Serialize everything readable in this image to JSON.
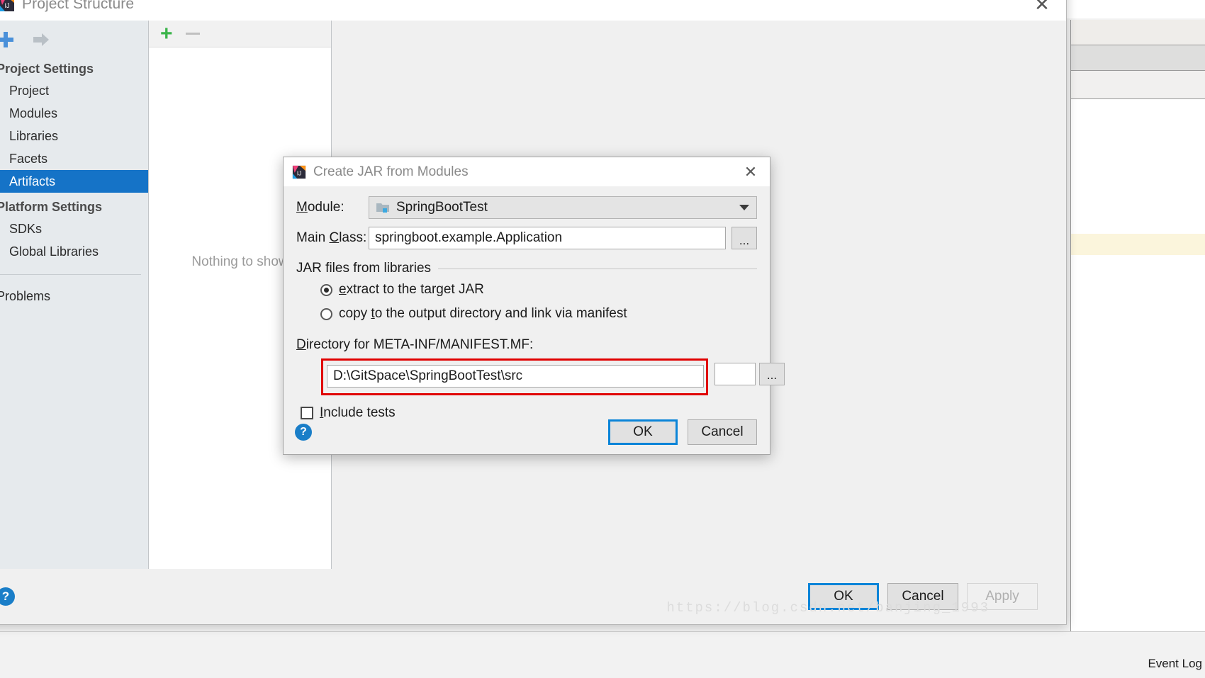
{
  "project_structure": {
    "title": "Project Structure",
    "title_icon": "intellij-idea-icon",
    "close_icon": "close-icon",
    "sidebar": {
      "toolbar": [
        {
          "name": "add-icon",
          "glyph": "+"
        },
        {
          "name": "forward-arrow-icon",
          "glyph": "⇨"
        }
      ],
      "groups": [
        {
          "title": "Project Settings",
          "items": [
            {
              "label": "Project",
              "selected": false
            },
            {
              "label": "Modules",
              "selected": false
            },
            {
              "label": "Libraries",
              "selected": false
            },
            {
              "label": "Facets",
              "selected": false
            },
            {
              "label": "Artifacts",
              "selected": true
            }
          ]
        },
        {
          "title": "Platform Settings",
          "items": [
            {
              "label": "SDKs",
              "selected": false
            },
            {
              "label": "Global Libraries",
              "selected": false
            }
          ]
        }
      ],
      "problems_label": "Problems"
    },
    "middle_panel": {
      "add_button": "+",
      "remove_button": "—",
      "empty_text": "Nothing to show"
    },
    "footer": {
      "help_label": "?",
      "ok_label": "OK",
      "cancel_label": "Cancel",
      "apply_label": "Apply",
      "apply_disabled": true,
      "watermark": "https://blog.csdn.net/banjing_1993"
    },
    "accent_color": "#1573c7",
    "focus_color": "#0a84d8"
  },
  "create_jar_dialog": {
    "title": "Create JAR from Modules",
    "title_icon": "intellij-idea-icon",
    "close_icon": "close-icon",
    "module": {
      "label_prefix": "",
      "label_mnemonic": "M",
      "label_suffix": "odule:",
      "icon": "module-folder-icon",
      "value": "SpringBootTest",
      "arrow_icon": "chevron-down-icon"
    },
    "main_class": {
      "label_prefix": "Main ",
      "label_mnemonic": "C",
      "label_suffix": "lass:",
      "value": "springboot.example.Application",
      "browse_label": "..."
    },
    "jar_files_group": {
      "title": "JAR files from libraries",
      "options": [
        {
          "label_prefix": "",
          "label_mnemonic": "e",
          "label_suffix": "xtract to the target JAR",
          "checked": true
        },
        {
          "label_prefix": "copy ",
          "label_mnemonic": "t",
          "label_suffix": "o the output directory and link via manifest",
          "checked": false
        }
      ]
    },
    "manifest_dir": {
      "label_mnemonic": "D",
      "label_suffix": "irectory for META-INF/MANIFEST.MF:",
      "value": "D:\\GitSpace\\SpringBootTest\\src",
      "browse_label": "...",
      "highlight_color": "#e00000"
    },
    "include_tests": {
      "label_mnemonic": "I",
      "label_suffix": "nclude tests",
      "checked": false
    },
    "footer": {
      "help_label": "?",
      "ok_label": "OK",
      "cancel_label": "Cancel"
    }
  },
  "ide_background": {
    "event_log_label": "Event Log"
  }
}
